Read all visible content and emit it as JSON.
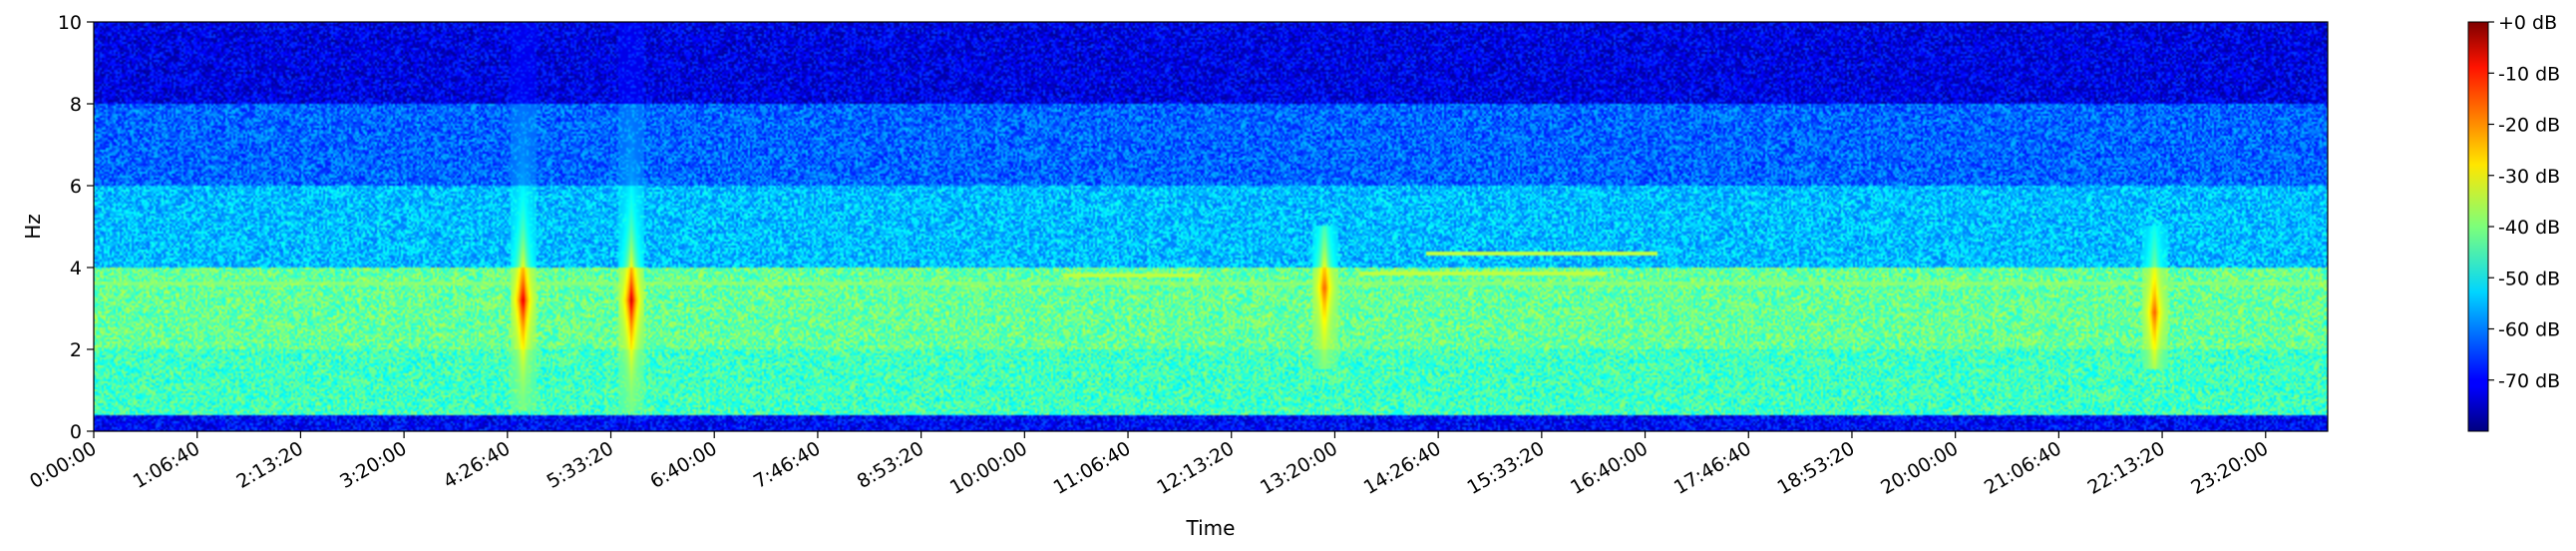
{
  "chart_data": {
    "type": "heatmap",
    "title": "",
    "xlabel": "Time",
    "ylabel": "Hz",
    "x_ticks": [
      "0:00:00",
      "1:06:40",
      "2:13:20",
      "3:20:00",
      "4:26:40",
      "5:33:20",
      "6:40:00",
      "7:46:40",
      "8:53:20",
      "10:00:00",
      "11:06:40",
      "12:13:20",
      "13:20:00",
      "14:26:40",
      "15:33:20",
      "16:40:00",
      "17:46:40",
      "18:53:20",
      "20:00:00",
      "21:06:40",
      "22:13:20",
      "23:20:00"
    ],
    "x_tick_seconds": [
      0,
      4000,
      8000,
      12000,
      16000,
      20000,
      24000,
      28000,
      32000,
      36000,
      40000,
      44000,
      48000,
      52000,
      56000,
      60000,
      64000,
      68000,
      72000,
      76000,
      80000,
      84000
    ],
    "xlim_seconds": [
      0,
      86400
    ],
    "y_ticks": [
      0,
      2,
      4,
      6,
      8,
      10
    ],
    "ylim": [
      0,
      10
    ],
    "colormap": "jet",
    "colorbar": {
      "ticks": [
        "+0 dB",
        "-10 dB",
        "-20 dB",
        "-30 dB",
        "-40 dB",
        "-50 dB",
        "-60 dB",
        "-70 dB"
      ],
      "tick_values": [
        0,
        -10,
        -20,
        -30,
        -40,
        -50,
        -60,
        -70
      ],
      "range": [
        -80,
        0
      ]
    },
    "approx_levels_db_by_band": [
      {
        "hz": [
          0,
          0.4
        ],
        "db": -70
      },
      {
        "hz": [
          0.4,
          2.0
        ],
        "db": -45
      },
      {
        "hz": [
          2.0,
          4.0
        ],
        "db": -42
      },
      {
        "hz": [
          4.0,
          6.0
        ],
        "db": -55
      },
      {
        "hz": [
          6.0,
          8.0
        ],
        "db": -62
      },
      {
        "hz": [
          8.0,
          10.0
        ],
        "db": -72
      }
    ],
    "events": [
      {
        "time_seconds": 16600,
        "hz": [
          0.5,
          10
        ],
        "peak_hz": 3.2,
        "peak_db": -5
      },
      {
        "time_seconds": 20800,
        "hz": [
          0.5,
          10
        ],
        "peak_hz": 3.2,
        "peak_db": -5
      },
      {
        "time_seconds": 47600,
        "hz": [
          1.5,
          5
        ],
        "peak_hz": 3.5,
        "peak_db": -15
      },
      {
        "time_seconds": 79700,
        "hz": [
          1.5,
          5
        ],
        "peak_hz": 2.9,
        "peak_db": -15
      }
    ],
    "harmonic_lines": [
      {
        "hz": 3.6,
        "time_seconds": [
          0,
          86400
        ],
        "db": -40
      },
      {
        "hz": 3.8,
        "time_seconds": [
          37500,
          42800
        ],
        "db": -35
      },
      {
        "hz": 3.85,
        "time_seconds": [
          49000,
          58500
        ],
        "db": -35
      },
      {
        "hz": 4.35,
        "time_seconds": [
          51500,
          60500
        ],
        "db": -35
      }
    ]
  }
}
